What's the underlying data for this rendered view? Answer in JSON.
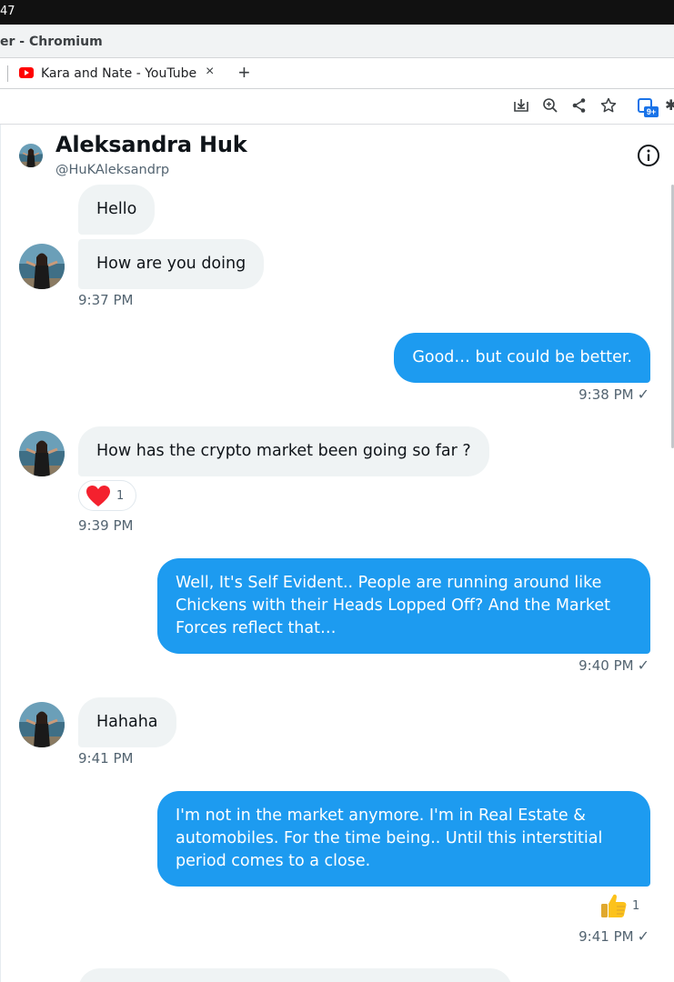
{
  "system": {
    "clock": "47"
  },
  "window": {
    "title": "er - Chromium"
  },
  "tabs": [
    {
      "title": "Kara and Nate - YouTube",
      "close": "×"
    }
  ],
  "new_tab": "+",
  "toolbar": {
    "extension_badge": "9+"
  },
  "chat": {
    "name": "Aleksandra Huk",
    "handle": "@HuKAleksandrp",
    "messages": {
      "m1": "Hello",
      "m2": "How are you doing",
      "t1": "9:37 PM",
      "m3": "Good… but could be better.",
      "t2": "9:38 PM",
      "m4": "How has the crypto market been going so far ?",
      "r1": {
        "emoji": "heart",
        "count": "1"
      },
      "t3": "9:39 PM",
      "m5": "Well, It's Self Evident.. People are running around like Chickens with their Heads Lopped Off? And the Market Forces reflect that…",
      "t4": "9:40 PM",
      "m6": "Hahaha",
      "t5": "9:41 PM",
      "m7": "I'm not in the market anymore. I'm in Real Estate & automobiles. For the time being.. Until this interstitial period comes to a close.",
      "r2": {
        "emoji": "thumbs-up",
        "count": "1"
      },
      "t6": "9:41 PM"
    },
    "read_check": "✓",
    "colors": {
      "outgoing": "#1d9bf0",
      "incoming": "#eff3f4",
      "heart": "#f4212e"
    }
  }
}
